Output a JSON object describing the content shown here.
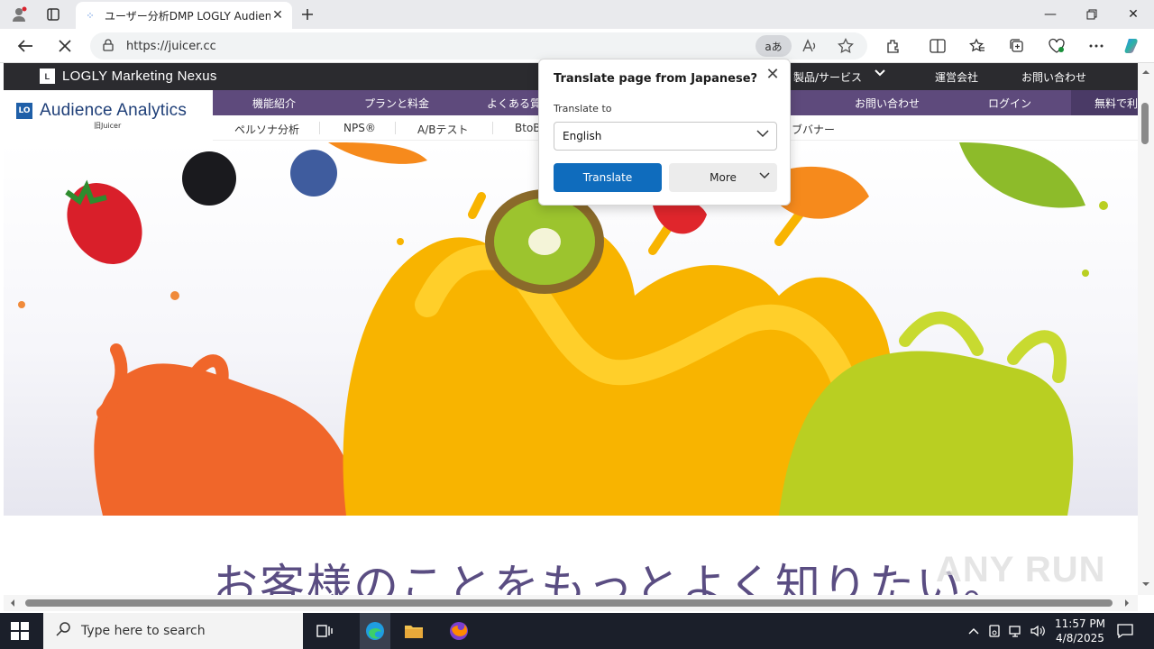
{
  "browser": {
    "tab_title": "ユーザー分析DMP LOGLY Audience",
    "url": "https://juicer.cc",
    "translate_pill": "aあ"
  },
  "site": {
    "top_brand": "LOGLY Marketing Nexus",
    "top_nav": [
      "製品/サービス",
      "運営会社",
      "お問い合わせ"
    ],
    "logo_mark": "LO",
    "logo_name": "Audience Analytics",
    "logo_sub": "旧Juicer",
    "main_nav": [
      "機能紹介",
      "プランと料金",
      "よくある質",
      "お問い合わせ",
      "ログイン",
      "無料で利"
    ],
    "sub_nav": [
      "ペルソナ分析",
      "NPS®",
      "A/Bテスト",
      "BtoB",
      "ブバナー"
    ],
    "headline": "お客様のことをもっとよく知りたい。"
  },
  "translate_popup": {
    "title": "Translate page from Japanese?",
    "label": "Translate to",
    "selected_language": "English",
    "translate_button": "Translate",
    "more_button": "More"
  },
  "watermark": "ANY RUN",
  "taskbar": {
    "search_placeholder": "Type here to search",
    "time": "11:57 PM",
    "date": "4/8/2025"
  },
  "colors": {
    "accent": "#0f6cbd",
    "site_purple": "#5e4a7c",
    "headline": "#5a4d82"
  }
}
